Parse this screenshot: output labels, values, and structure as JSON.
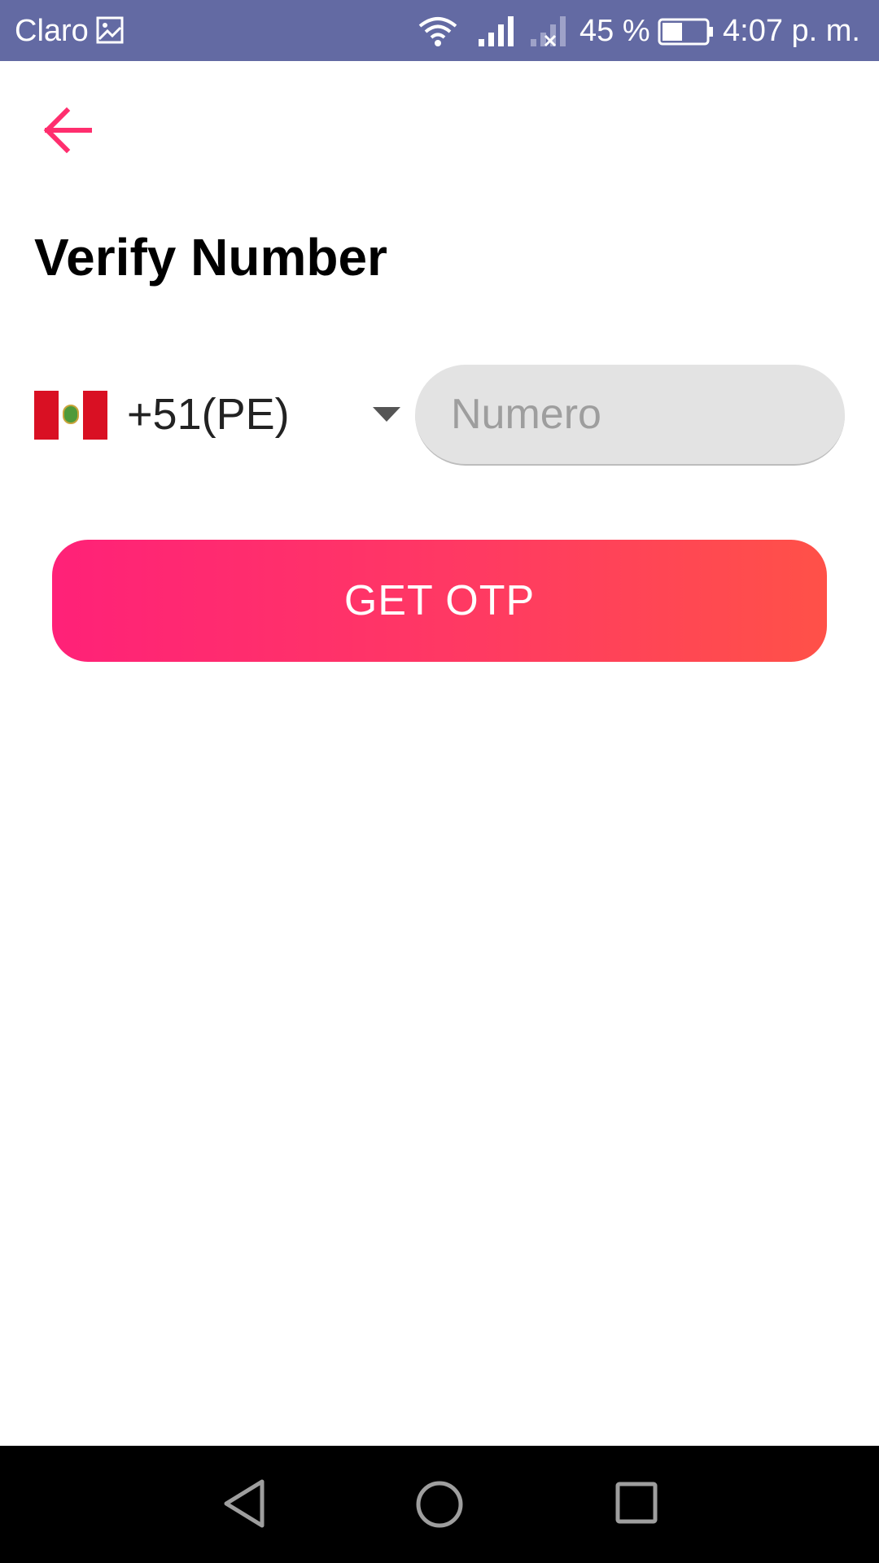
{
  "status_bar": {
    "carrier": "Claro",
    "battery_percent": "45 %",
    "time": "4:07 p. m.",
    "background_color": "#636aa3",
    "icons": [
      "image-notification-icon",
      "wifi-icon",
      "cell-signal-icon",
      "no-signal-icon",
      "battery-icon"
    ]
  },
  "header": {
    "back_icon": "arrow-left-icon",
    "title": "Verify Number"
  },
  "phone_form": {
    "country_code": "+51(PE)",
    "country_flag": "peru-flag-icon",
    "input_value": "",
    "input_placeholder": "Numero"
  },
  "actions": {
    "otp_label": "GET OTP",
    "gradient_start": "#ff2178",
    "gradient_end": "#ff5148"
  },
  "nav_bar": {
    "icons": [
      "nav-back-icon",
      "nav-home-icon",
      "nav-recents-icon"
    ]
  },
  "colors": {
    "accent": "#ff2e6e",
    "input_background": "#e3e3e3"
  }
}
